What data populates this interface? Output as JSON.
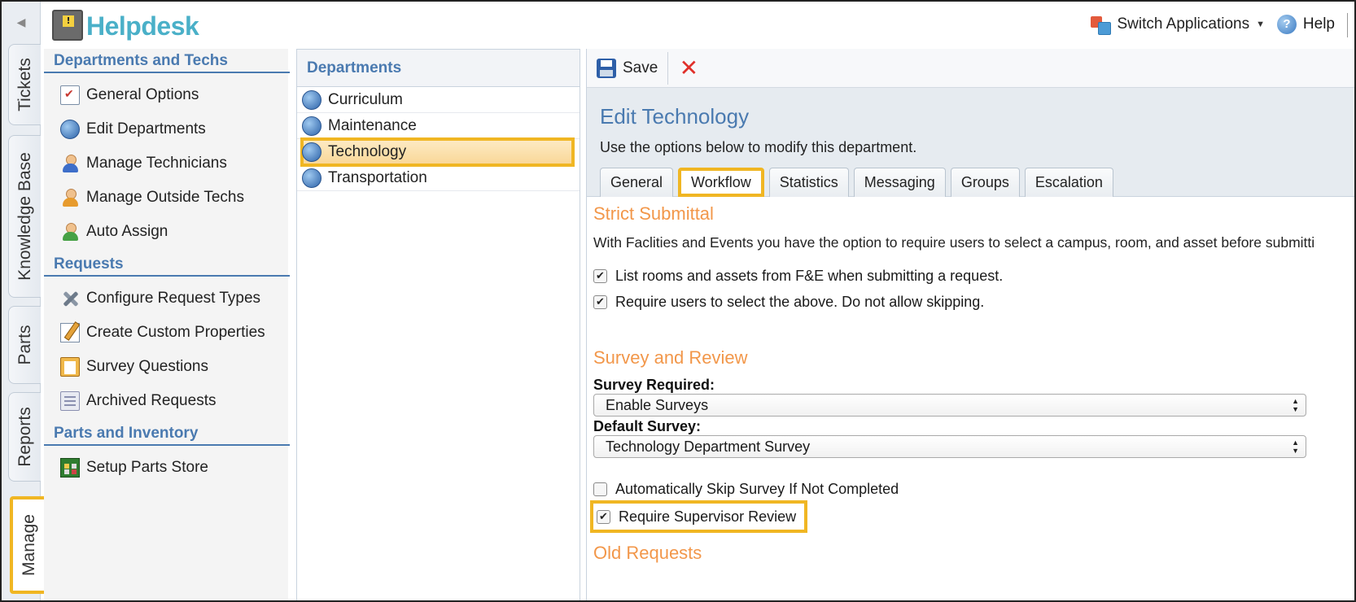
{
  "app": {
    "title": "Helpdesk"
  },
  "header": {
    "switch_label": "Switch Applications",
    "help_label": "Help"
  },
  "vtabs": [
    "Tickets",
    "Knowledge Base",
    "Parts",
    "Reports",
    "Manage"
  ],
  "leftnav": {
    "sections": [
      {
        "title": "Departments and Techs",
        "items": [
          "General Options",
          "Edit Departments",
          "Manage Technicians",
          "Manage Outside Techs",
          "Auto Assign"
        ]
      },
      {
        "title": "Requests",
        "items": [
          "Configure Request Types",
          "Create Custom Properties",
          "Survey Questions",
          "Archived Requests"
        ]
      },
      {
        "title": "Parts and Inventory",
        "items": [
          "Setup Parts Store"
        ]
      }
    ]
  },
  "departments": {
    "title": "Departments",
    "items": [
      "Curriculum",
      "Maintenance",
      "Technology",
      "Transportation"
    ],
    "selected": "Technology"
  },
  "toolbar": {
    "save_label": "Save"
  },
  "edit": {
    "title": "Edit Technology",
    "subtitle": "Use the options below to modify this department.",
    "tabs": [
      "General",
      "Workflow",
      "Statistics",
      "Messaging",
      "Groups",
      "Escalation"
    ],
    "active_tab": "Workflow"
  },
  "strict": {
    "title": "Strict Submittal",
    "text": "With Faclities and Events you have the option to require users to select a campus, room, and asset before submitti",
    "opt1": "List rooms and assets from F&E when submitting a request.",
    "opt2": "Require users to select the above. Do not allow skipping.",
    "opt1_checked": true,
    "opt2_checked": true
  },
  "survey": {
    "title": "Survey and Review",
    "required_label": "Survey Required:",
    "required_value": "Enable Surveys",
    "default_label": "Default Survey:",
    "default_value": "Technology Department Survey",
    "skip_label": "Automatically Skip Survey If Not Completed",
    "skip_checked": false,
    "review_label": "Require Supervisor Review",
    "review_checked": true
  },
  "old": {
    "title": "Old Requests"
  },
  "colors": {
    "accent": "#4a7ab0",
    "highlight": "#f0b623",
    "section_orange": "#f2974a",
    "logo": "#4ab0c8"
  }
}
